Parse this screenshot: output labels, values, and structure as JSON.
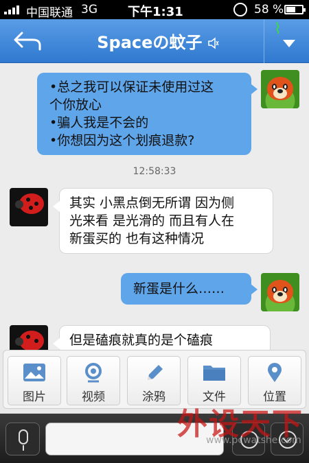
{
  "status_bar": {
    "carrier": "中国联通",
    "network": "3G",
    "time": "下午1:31",
    "battery_percent": "58 %",
    "battery_level": 0.58
  },
  "nav": {
    "title": "Spaceの蚊子",
    "back_icon": "back-arrow-icon",
    "mute_icon": "speaker-muted-icon",
    "menu_icon": "dropdown-triangle-icon",
    "logo_icon": "razer-logo-icon"
  },
  "messages": [
    {
      "direction": "out",
      "lines": [
        "•总之我可以保证未使用过这",
        "个你放心",
        "•骗人我是不会的",
        "•你想因为这个划痕退款?"
      ]
    },
    {
      "type": "timestamp",
      "text": "12:58:33"
    },
    {
      "direction": "in",
      "lines": [
        "其实 小黑点倒无所谓 因为侧",
        "光来看 是光滑的 而且有人在",
        "新蛋买的 也有这种情况"
      ]
    },
    {
      "direction": "out",
      "lines": [
        "新蛋是什么……"
      ]
    },
    {
      "direction": "in",
      "lines": [
        "但是磕痕就真的是个磕痕"
      ]
    }
  ],
  "tools": [
    {
      "label": "图片",
      "icon": "image-icon"
    },
    {
      "label": "视频",
      "icon": "video-icon"
    },
    {
      "label": "涂鸦",
      "icon": "pencil-icon"
    },
    {
      "label": "文件",
      "icon": "folder-icon"
    },
    {
      "label": "位置",
      "icon": "location-pin-icon"
    }
  ],
  "watermark": {
    "text": "外设天下",
    "url": "www.pcwatshe.com"
  },
  "colors": {
    "nav_blue": "#2f79cf",
    "bubble_out": "#5fa5ea",
    "bubble_in": "#ffffff"
  }
}
